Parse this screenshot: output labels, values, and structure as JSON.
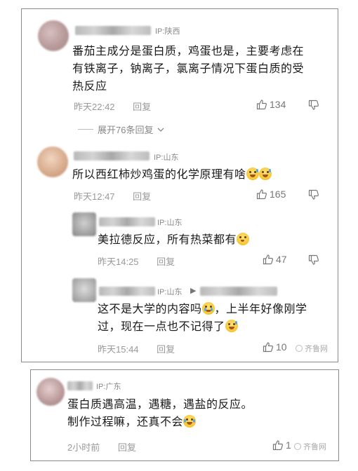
{
  "comments": [
    {
      "ip": "IP:陕西",
      "text_lines": [
        "番茄主成分是蛋白质，鸡蛋也是，主要考虑在",
        "有铁离子，钠离子，氯离子情况下蛋白质的受",
        "热反应"
      ],
      "time": "昨天22:42",
      "reply_label": "回复",
      "likes": "134",
      "expand_label": "展开76条回复"
    },
    {
      "ip": "IP:山东",
      "text": "所以西红柿炒鸡蛋的化学原理有啥",
      "emoji": [
        "sweat-laugh-emoji",
        "sweat-laugh-emoji"
      ],
      "time": "昨天12:47",
      "reply_label": "回复",
      "likes": "165"
    },
    {
      "ip": "IP:山东",
      "text": "美拉德反应，所有热菜都有",
      "emoji": [
        "flushed-emoji"
      ],
      "time": "昨天14:25",
      "reply_label": "回复",
      "likes": "47"
    },
    {
      "ip": "IP:山东",
      "reply_arrow": "▶",
      "text_lines": [
        "这不是大学的内容吗",
        "，上半年好像刚学",
        "过，现在一点也不记得了"
      ],
      "time": "昨天15:44",
      "reply_label": "回复",
      "likes": "10"
    },
    {
      "ip": "IP:广东",
      "text_lines": [
        "蛋白质遇高温，遇糖，遇盐的反应。",
        "制作过程嘛，还真不会"
      ],
      "time": "2小时前",
      "reply_label": "回复",
      "likes": "1"
    }
  ],
  "watermark": "齐鲁网",
  "icons": {
    "like": "thumbs-up-icon",
    "dislike": "thumbs-down-icon",
    "expand": "chevron-down-icon"
  }
}
